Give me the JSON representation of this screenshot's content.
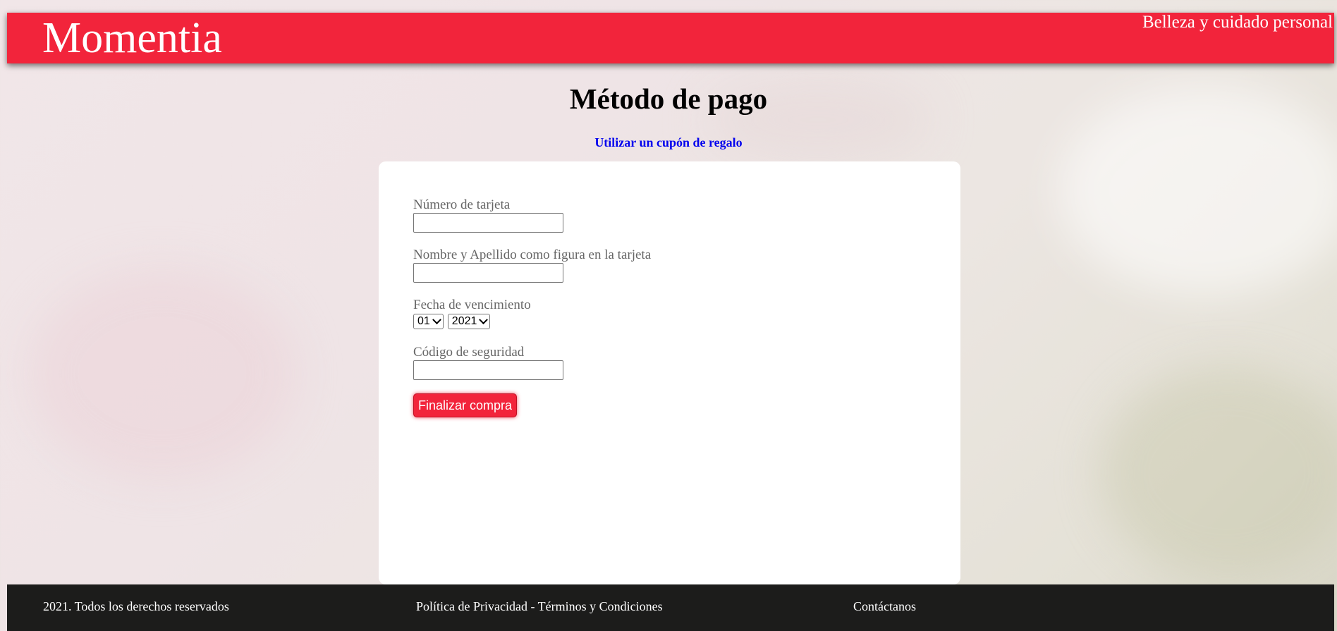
{
  "header": {
    "brand": "Momentia",
    "tagline": "Belleza y cuidado personal"
  },
  "main": {
    "title": "Método de pago",
    "coupon_link": "Utilizar un cupón de regalo"
  },
  "form": {
    "card_number": {
      "label": "Número de tarjeta",
      "value": ""
    },
    "card_name": {
      "label": "Nombre y Apellido como figura en la tarjeta",
      "value": ""
    },
    "expiry": {
      "label": "Fecha de vencimiento",
      "month": "01",
      "year": "2021"
    },
    "security_code": {
      "label": "Código de seguridad",
      "value": ""
    },
    "submit_label": "Finalizar compra"
  },
  "footer": {
    "copyright": "2021. Todos los derechos reservados",
    "legal": "Política de Privacidad - Términos y Condiciones",
    "contact": "Contáctanos"
  },
  "colors": {
    "accent": "#f2243b",
    "footer_bg": "#1c1c1b",
    "link": "#0000ee"
  }
}
